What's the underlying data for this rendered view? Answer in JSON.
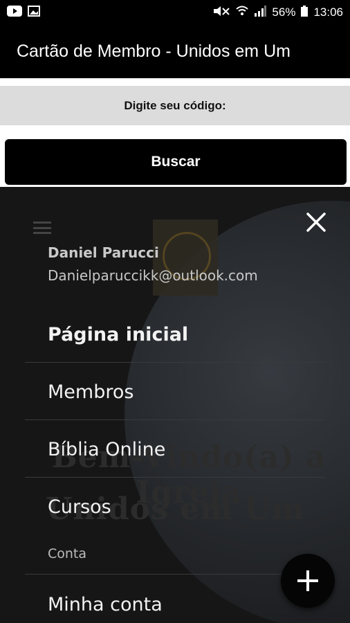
{
  "status_bar": {
    "left_icons": [
      "youtube-icon",
      "image-icon"
    ],
    "right_icons": [
      "mute-icon",
      "wifi-icon",
      "signal-icon",
      "battery-icon"
    ],
    "battery": "56%",
    "time": "13:06"
  },
  "app_bar": {
    "title": "Cartão de Membro - Unidos em Um"
  },
  "form": {
    "code_label": "Digite seu código:",
    "search_button": "Buscar"
  },
  "drawer": {
    "user": {
      "name": "Daniel Parucci",
      "email": "Danielparuccikk@outlook.com"
    },
    "items": [
      {
        "label": "Página inicial",
        "active": true
      },
      {
        "label": "Membros"
      },
      {
        "label": "Bíblia Online"
      },
      {
        "label": "Cursos"
      }
    ],
    "section_label": "Conta",
    "account_items": [
      {
        "label": "Minha conta"
      }
    ],
    "close_icon": "close-icon"
  },
  "background": {
    "watermark_line1": "Bem-Vindo(a) a Igreja",
    "watermark_line2": "Unidos em Um"
  },
  "fab": {
    "icon": "plus-icon"
  },
  "colors": {
    "app_bar": "#000000",
    "drawer_bg": "#161616",
    "label_band": "#dcdcdc"
  }
}
